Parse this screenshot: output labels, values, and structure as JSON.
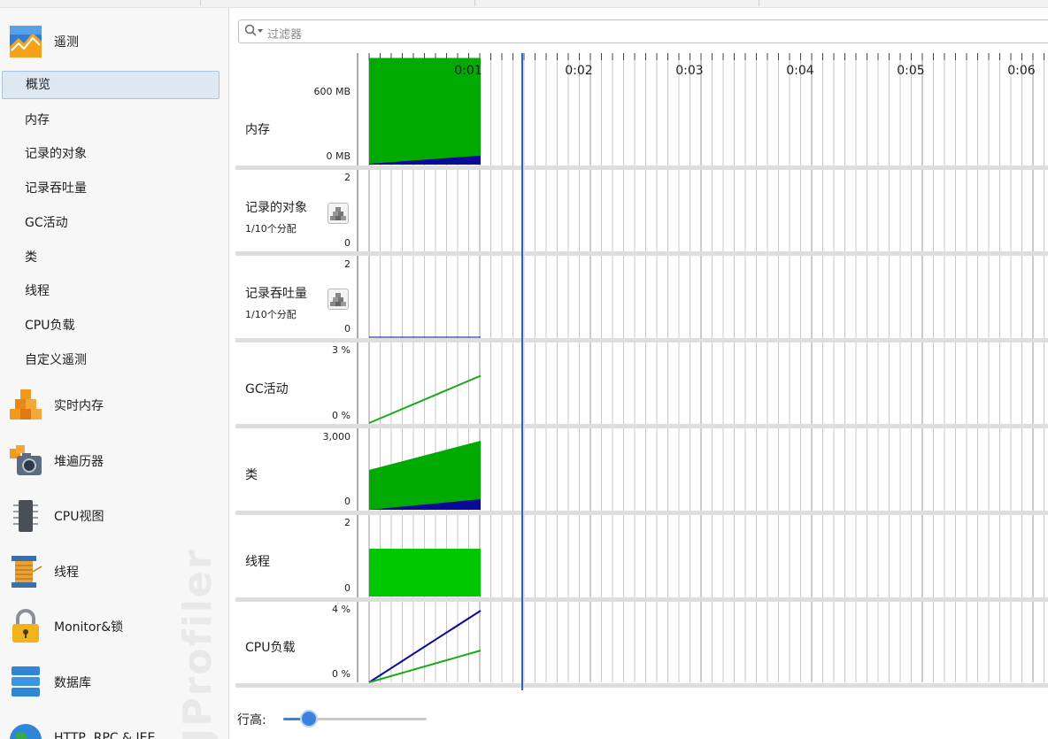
{
  "sidebar": {
    "header_section": "遥测",
    "telemetry_items": [
      "概览",
      "内存",
      "记录的对象",
      "记录吞吐量",
      "GC活动",
      "类",
      "线程",
      "CPU负载",
      "自定义遥测"
    ],
    "selected_item": "概览",
    "sections": [
      "实时内存",
      "堆遍历器",
      "CPU视图",
      "线程",
      "Monitor&锁",
      "数据库",
      "HTTP, RPC & JEE"
    ],
    "watermark": "JProfiler"
  },
  "filter": {
    "placeholder": "过滤器"
  },
  "timeline": {
    "x_ticks": [
      "0:01",
      "0:02",
      "0:03",
      "0:04",
      "0:05",
      "0:06"
    ],
    "rows": [
      {
        "label": "内存",
        "sub": "",
        "y_max": "600 MB",
        "y_min": "0 MB",
        "chart": "memory"
      },
      {
        "label": "记录的对象",
        "sub": "1/10个分配",
        "y_max": "2",
        "y_min": "0",
        "chart": "objects"
      },
      {
        "label": "记录吞吐量",
        "sub": "1/10个分配",
        "y_max": "2",
        "y_min": "0",
        "chart": "throughput"
      },
      {
        "label": "GC活动",
        "sub": "",
        "y_max": "3 %",
        "y_min": "0 %",
        "chart": "gc"
      },
      {
        "label": "类",
        "sub": "",
        "y_max": "3,000",
        "y_min": "0",
        "chart": "classes"
      },
      {
        "label": "线程",
        "sub": "",
        "y_max": "2",
        "y_min": "0",
        "chart": "threads"
      },
      {
        "label": "CPU负载",
        "sub": "",
        "y_max": "4 %",
        "y_min": "0 %",
        "chart": "cpu"
      }
    ]
  },
  "chart_data": [
    {
      "type": "area",
      "title": "内存",
      "ylim": [
        0,
        600
      ],
      "unit": "MB",
      "x": [
        0,
        1
      ],
      "series": [
        {
          "values": [
            588,
            588
          ],
          "color": "#00aa00"
        },
        {
          "values": [
            5,
            50
          ],
          "color": "#0a0a9a"
        }
      ]
    },
    {
      "type": "area",
      "title": "类",
      "ylim": [
        0,
        3000
      ],
      "x": [
        0,
        1
      ],
      "series": [
        {
          "values": [
            1500,
            2600
          ],
          "color": "#00aa00"
        },
        {
          "values": [
            0,
            400
          ],
          "color": "#0a0a9a"
        }
      ]
    },
    {
      "type": "area",
      "title": "线程",
      "ylim": [
        0,
        2
      ],
      "x": [
        0,
        1
      ],
      "series": [
        {
          "values": [
            1.2,
            1.2
          ],
          "color": "#00c800"
        }
      ]
    },
    {
      "type": "line",
      "title": "GC活动",
      "ylim": [
        0,
        3
      ],
      "unit": "%",
      "x": [
        0,
        1
      ],
      "series": [
        {
          "values": [
            0,
            1.8
          ],
          "color": "#1aaa1a"
        }
      ]
    },
    {
      "type": "line",
      "title": "CPU负载",
      "ylim": [
        0,
        4
      ],
      "unit": "%",
      "x": [
        0,
        1
      ],
      "series": [
        {
          "values": [
            0,
            3.6
          ],
          "color": "#0a0a9a"
        },
        {
          "values": [
            0,
            1.6
          ],
          "color": "#1aaa1a"
        }
      ]
    }
  ],
  "footer": {
    "row_height_label": "行高:",
    "row_height_level": 0.18
  },
  "colors": {
    "accent": "#3b82e0",
    "green": "#00aa00",
    "dark_blue": "#0a0a9a",
    "cursor_line": "#2b5fd9"
  }
}
